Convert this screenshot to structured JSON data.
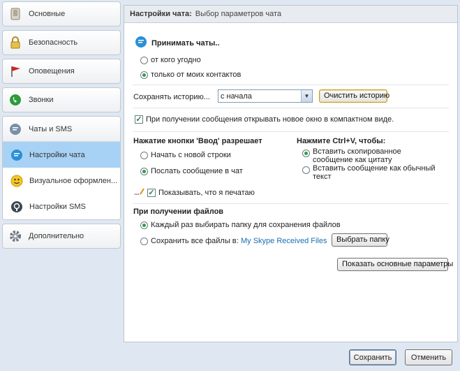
{
  "sidebar": {
    "items": [
      {
        "label": "Основные",
        "icon": "phone-settings-icon"
      },
      {
        "label": "Безопасность",
        "icon": "lock-icon"
      },
      {
        "label": "Оповещения",
        "icon": "red-flag-icon"
      },
      {
        "label": "Звонки",
        "icon": "green-phone-icon"
      }
    ],
    "chat_group": {
      "label": "Чаты и SMS",
      "icon": "chat-bubble-icon",
      "subitems": [
        {
          "label": "Настройки чата",
          "icon": "chat-bubble-icon",
          "active": true
        },
        {
          "label": "Визуальное оформлен...",
          "icon": "smiley-icon",
          "active": false
        },
        {
          "label": "Настройки SMS",
          "icon": "sms-icon",
          "active": false
        }
      ]
    },
    "advanced": {
      "label": "Дополнительно",
      "icon": "gear-icon"
    }
  },
  "header": {
    "title": "Настройки чата:",
    "subtitle": "Выбор параметров чата"
  },
  "accept": {
    "heading": "Принимать чаты..",
    "option_anyone": "от кого угодно",
    "option_contacts": "только от моих контактов",
    "selected": "contacts"
  },
  "history": {
    "label": "Сохранять историю...",
    "value": "с начала",
    "clear_button": "Очистить историю"
  },
  "compact_window": {
    "label": "При получении сообщения открывать новое окно в компактном виде.",
    "checked": true
  },
  "enter_key": {
    "heading": "Нажатие кнопки 'Ввод' разрешает",
    "option_newline": "Начать с новой строки",
    "option_send": "Послать сообщение в чат",
    "selected": "send"
  },
  "ctrl_v": {
    "heading": "Нажмите Ctrl+V, чтобы:",
    "option_quote": "Вставить скопированное сообщение как цитату",
    "option_plain": "Вставить сообщение как обычный текст",
    "selected": "quote"
  },
  "typing": {
    "label": "Показывать, что я печатаю",
    "checked": true,
    "icon": "pencil-icon"
  },
  "files": {
    "heading": "При получении файлов",
    "option_ask": "Каждый раз выбирать папку для сохранения файлов",
    "option_save_all": "Сохранить все файлы в:",
    "folder": "My Skype Received Files",
    "choose_button": "Выбрать папку",
    "selected": "ask"
  },
  "basic_settings_button": "Показать основные параметры",
  "footer": {
    "save": "Сохранить",
    "cancel": "Отменить"
  }
}
